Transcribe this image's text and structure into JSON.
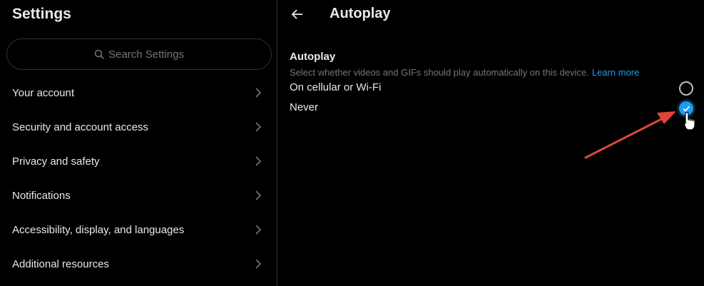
{
  "sidebar": {
    "title": "Settings",
    "search_placeholder": "Search Settings",
    "items": [
      {
        "label": "Your account"
      },
      {
        "label": "Security and account access"
      },
      {
        "label": "Privacy and safety"
      },
      {
        "label": "Notifications"
      },
      {
        "label": "Accessibility, display, and languages"
      },
      {
        "label": "Additional resources"
      }
    ]
  },
  "detail": {
    "title": "Autoplay",
    "section_heading": "Autoplay",
    "description": "Select whether videos and GIFs should play automatically on this device.",
    "learn_more": "Learn more",
    "options": [
      {
        "label": "On cellular or Wi-Fi",
        "selected": false
      },
      {
        "label": "Never",
        "selected": true
      }
    ]
  },
  "colors": {
    "background": "#000000",
    "accent": "#1d9bf0",
    "annotation_arrow": "#e0453b",
    "muted_text": "#71767b"
  }
}
